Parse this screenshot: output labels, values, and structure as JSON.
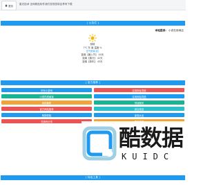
{
  "tab": {
    "home_label": "首页"
  },
  "notice_text": "星光技术  全网精品软件我们发现您将会享有下载",
  "sections": {
    "weather_title": "[ 公告栏 ]",
    "tools_title": "[ 官方推荐 ]",
    "bottom_title": "[ 特色工具 ]"
  },
  "provider": {
    "label": "本站提供：",
    "name": "小说在用网店"
  },
  "weather": {
    "condition": "阴晴",
    "temp": "7℃  东 南  温度 %",
    "status": "空气质量(优)",
    "lines": [
      "距离【暴入节】  40天",
      "距离【春分】  42天",
      "距离【新年】  43天"
    ]
  },
  "colors": {
    "blue": "#1e9bf0",
    "green": "#1ab394",
    "orange": "#f0a53a",
    "red": "#e95454",
    "teal": "#2ec0c9"
  },
  "buttons": [
    {
      "label": "好玩小游戏",
      "color": "#1e9bf0"
    },
    {
      "label": "实用网址导航",
      "color": "#e95454"
    },
    {
      "label": "小说在线阅读",
      "color": "#1ab394"
    },
    {
      "label": "实用网站导航",
      "color": "#1e9bf0"
    },
    {
      "label": "网络兼职",
      "color": "#f0a53a"
    },
    {
      "label": "同城服务",
      "color": "#1ab394"
    },
    {
      "label": "官方网站推荐",
      "color": "#e95454"
    },
    {
      "label": "综合信息",
      "color": "#2ec0c9"
    },
    {
      "label": "购物导航",
      "color": "#1e9bf0"
    },
    {
      "label": "影视大全",
      "color": "#1e9bf0"
    },
    {
      "label": "兑换码分享",
      "color": "#e95454"
    },
    {
      "label": "更多推荐",
      "color": "#f0a53a"
    }
  ],
  "watermark": {
    "title": "酷数据",
    "subtitle": "KUIDC"
  }
}
